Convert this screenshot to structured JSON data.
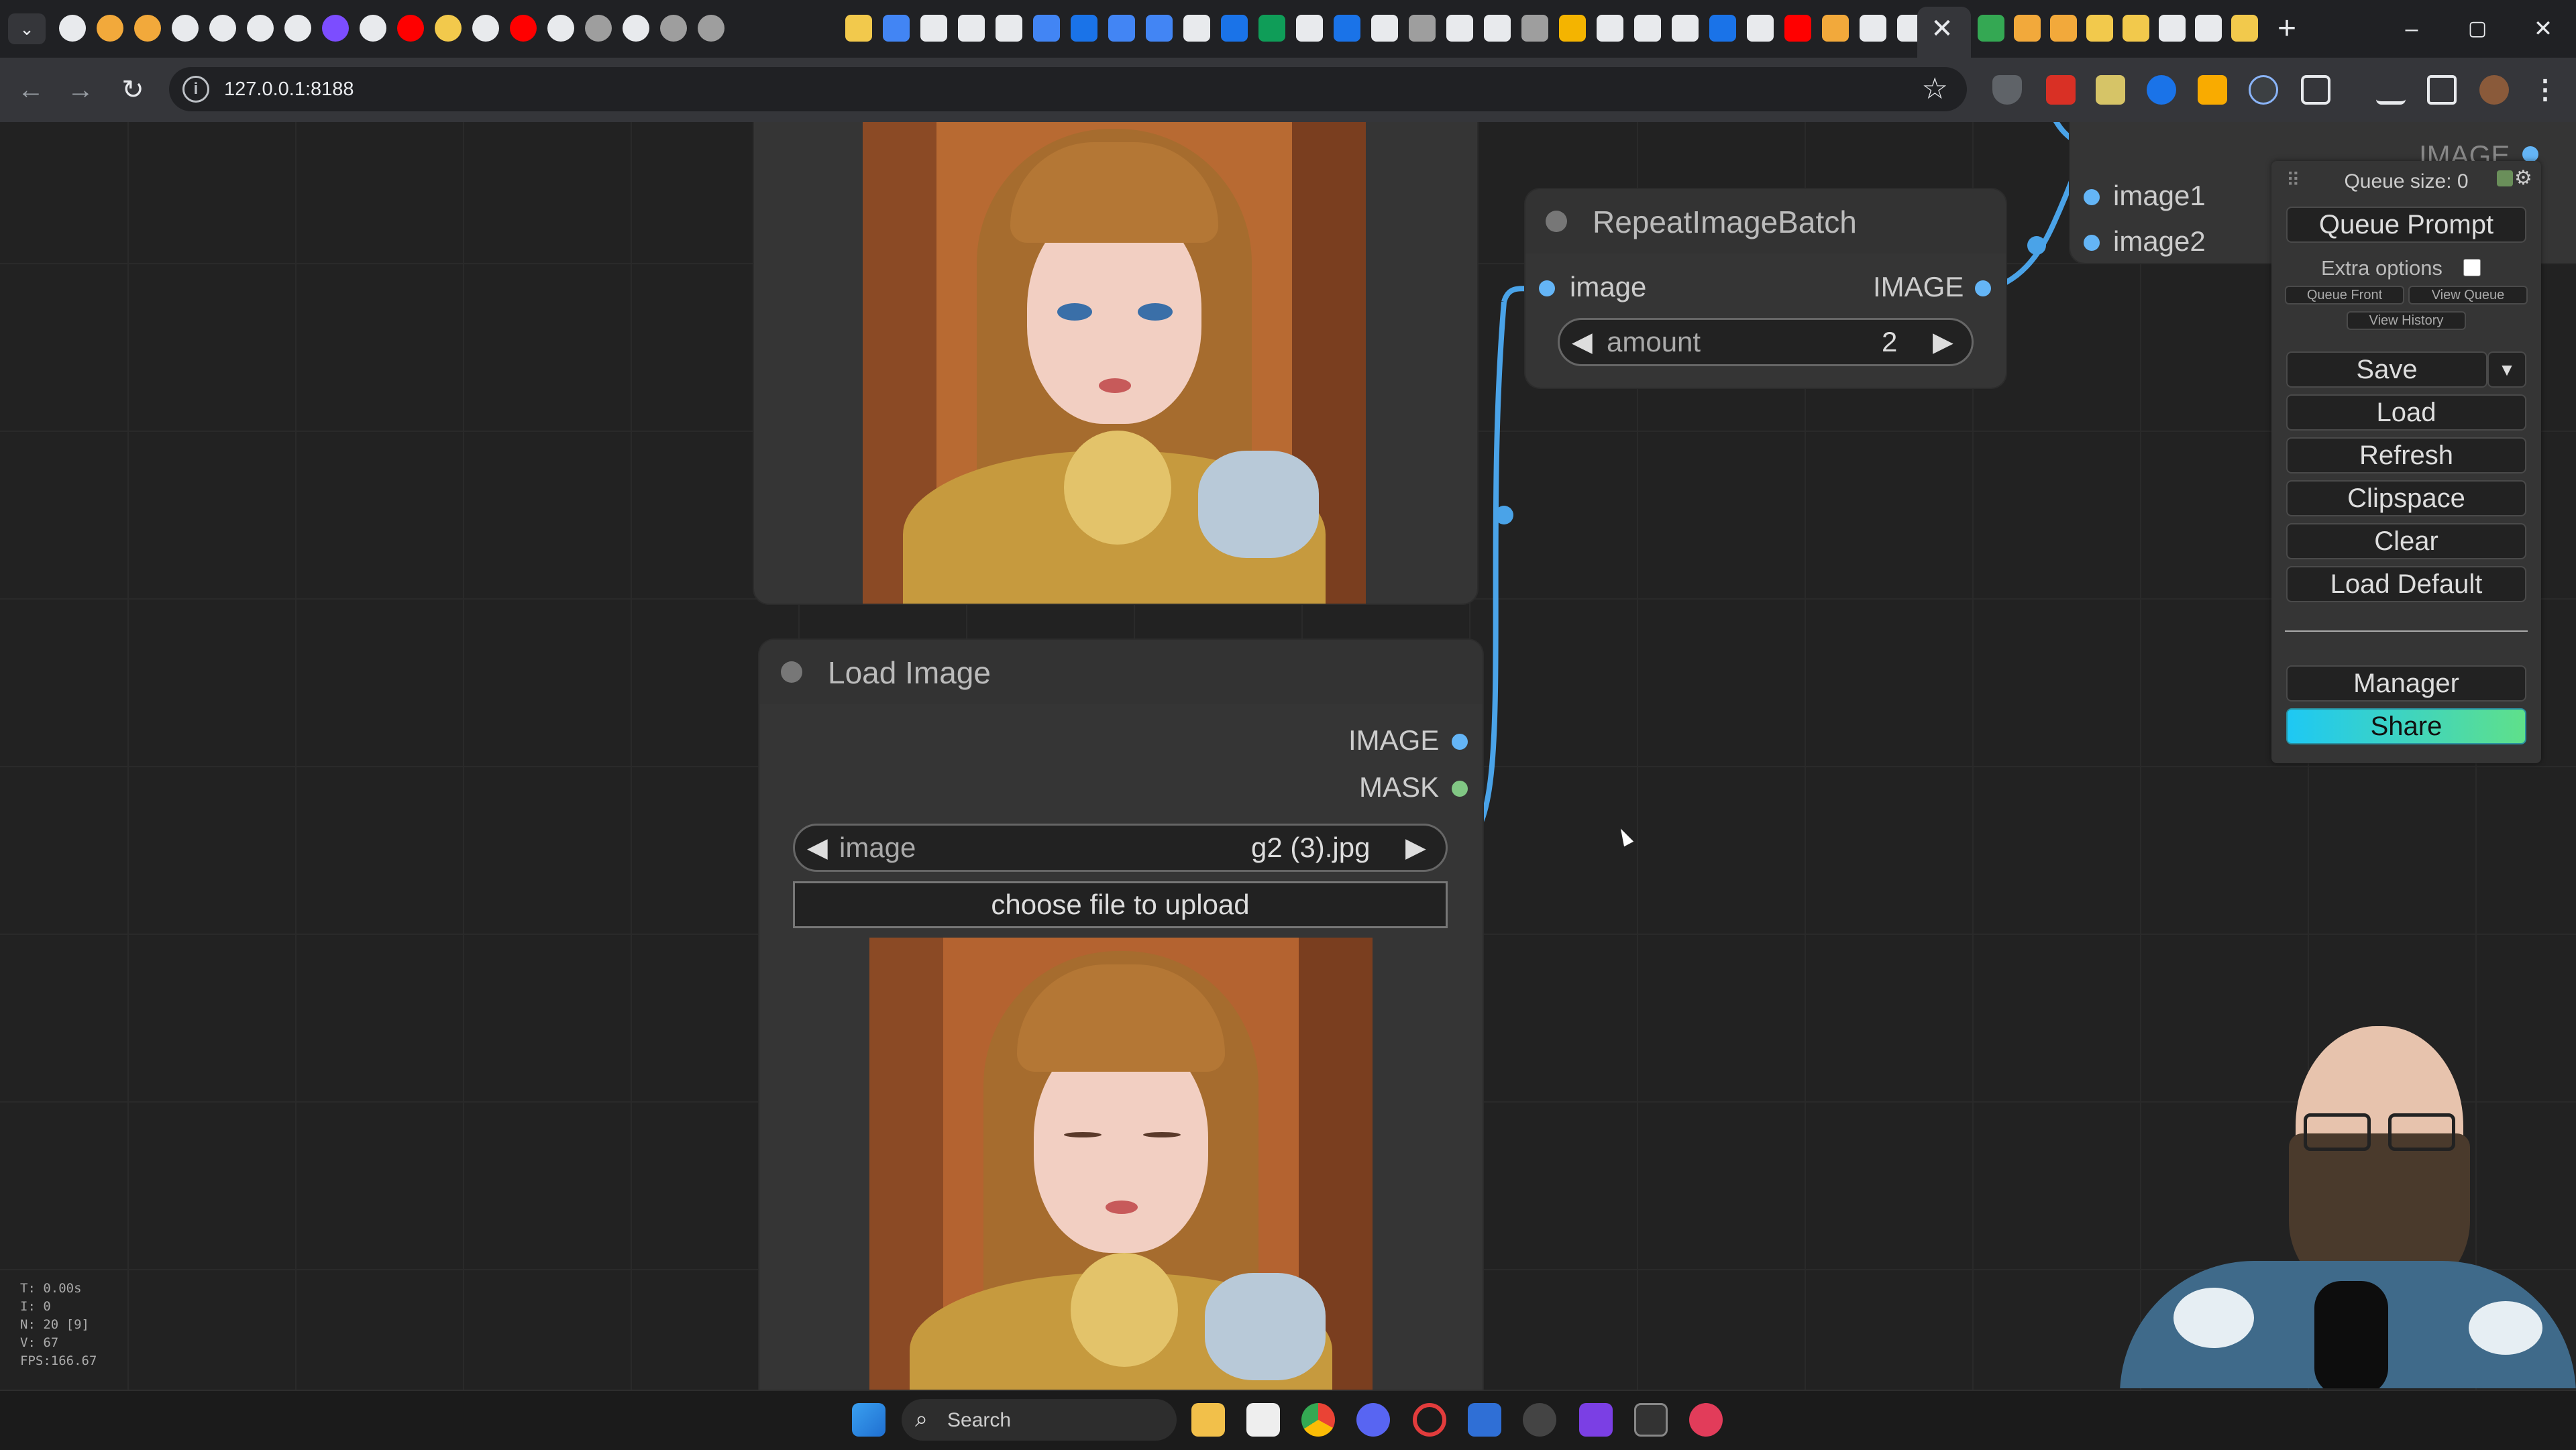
{
  "browser": {
    "url": "127.0.0.1:8188",
    "tab_close_glyph": "✕",
    "new_tab_glyph": "+",
    "tab_menu_glyph": "⌄",
    "back_glyph": "←",
    "forward_glyph": "→",
    "reload_glyph": "↻",
    "star_glyph": "☆",
    "minimize_glyph": "–",
    "maximize_glyph": "▢",
    "close_glyph": "✕",
    "info_glyph": "i"
  },
  "nodes": {
    "top_output": {
      "slot_labels": [
        "image1",
        "image2"
      ],
      "output_label": "IMAGE"
    },
    "repeat_image_batch": {
      "title": "RepeatImageBatch",
      "input_label": "image",
      "output_label": "IMAGE",
      "widget_label": "amount",
      "widget_value": "2",
      "arrow_left": "◀",
      "arrow_right": "▶"
    },
    "load_image": {
      "title": "Load Image",
      "output_image_label": "IMAGE",
      "output_mask_label": "MASK",
      "widget_label": "image",
      "widget_value": "g2 (3).jpg",
      "arrow_left": "◀",
      "arrow_right": "▶",
      "upload_label": "choose file to upload"
    }
  },
  "menu": {
    "queue_size": "Queue size: 0",
    "queue_prompt": "Queue Prompt",
    "extra_options": "Extra options",
    "queue_front": "Queue Front",
    "view_queue": "View Queue",
    "view_history": "View History",
    "save": "Save",
    "save_dropdown": "▼",
    "load": "Load",
    "refresh": "Refresh",
    "clipspace": "Clipspace",
    "clear": "Clear",
    "load_default": "Load Default",
    "manager": "Manager",
    "share": "Share",
    "drag_glyph": "⠿",
    "gear_glyph": "⚙"
  },
  "stats": {
    "t": "T: 0.00s",
    "i": "I: 0",
    "n": "N: 20 [9]",
    "v": "V: 67",
    "fps": "FPS:166.67"
  },
  "taskbar": {
    "search_label": "Search",
    "search_glyph": "⌕"
  },
  "colors": {
    "wire": "#4aa3e8",
    "image_slot": "#64b5f6",
    "mask_slot": "#81c784",
    "share_gradient_start": "#1ec8f4",
    "share_gradient_end": "#5fe08a"
  }
}
